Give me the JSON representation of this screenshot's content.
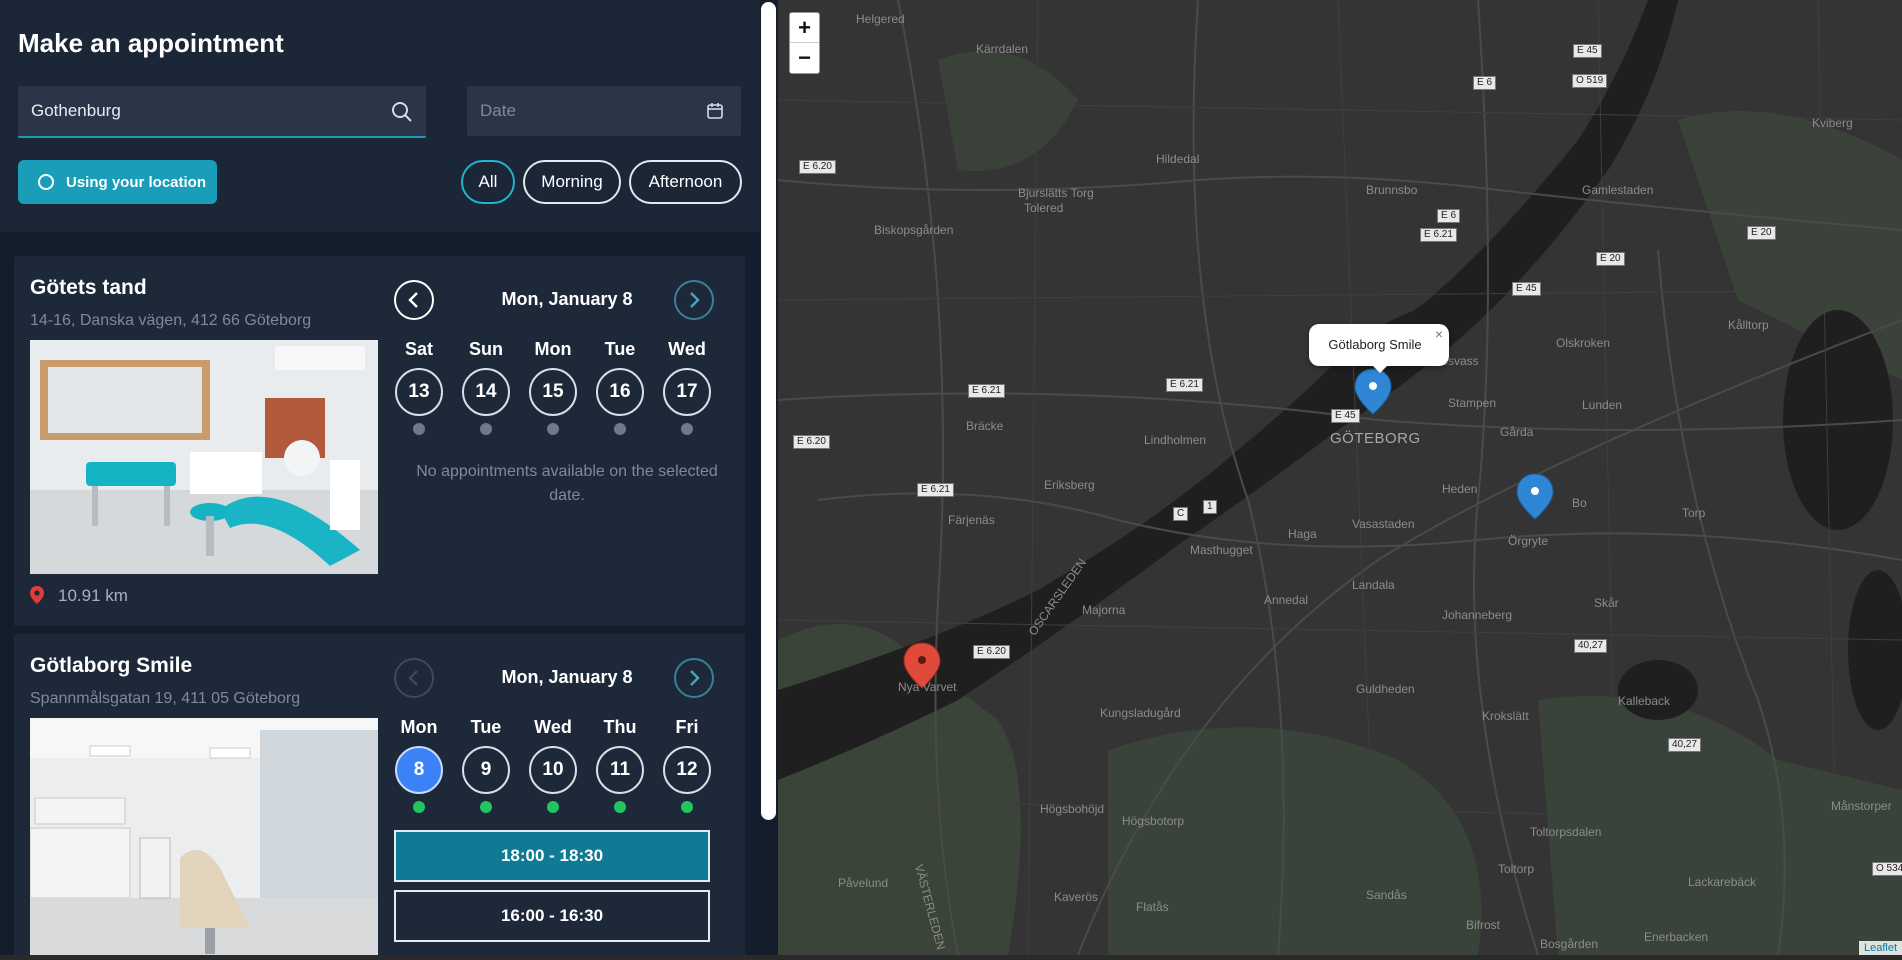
{
  "header": {
    "title": "Make an appointment"
  },
  "search": {
    "value": "Gothenburg",
    "date_placeholder": "Date"
  },
  "location_button": {
    "label": "Using your location"
  },
  "filters": [
    "All",
    "Morning",
    "Afternoon"
  ],
  "filters_active": "All",
  "clinics": [
    {
      "name": "Götets tand",
      "address": "14-16, Danska vägen, 412 66 Göteborg",
      "distance": "10.91 km",
      "date_title": "Mon, January 8",
      "days": [
        {
          "dow": "Sat",
          "num": "13"
        },
        {
          "dow": "Sun",
          "num": "14"
        },
        {
          "dow": "Mon",
          "num": "15"
        },
        {
          "dow": "Tue",
          "num": "16"
        },
        {
          "dow": "Wed",
          "num": "17"
        }
      ],
      "message": "No appointments available on the selected date."
    },
    {
      "name": "Götlaborg Smile",
      "address": "Spannmålsgatan 19, 411 05 Göteborg",
      "date_title": "Mon, January 8",
      "days": [
        {
          "dow": "Mon",
          "num": "8"
        },
        {
          "dow": "Tue",
          "num": "9"
        },
        {
          "dow": "Wed",
          "num": "10"
        },
        {
          "dow": "Thu",
          "num": "11"
        },
        {
          "dow": "Fri",
          "num": "12"
        }
      ],
      "slots": [
        "18:00 - 18:30",
        "16:00 - 16:30"
      ]
    }
  ],
  "map": {
    "zoom_in": "+",
    "zoom_out": "−",
    "popup": "Götlaborg Smile",
    "popup_close": "×",
    "attribution": "Leaflet",
    "labels": {
      "helgered": "Helgered",
      "karrdalen": "Kärrdalen",
      "hildedal": "Hildedal",
      "bjurslatts": "Bjurslätts Torg",
      "tolered": "Tolered",
      "biskops": "Biskopsgården",
      "brunnsbo": "Brunnsbo",
      "gamlestaden": "Gamlestaden",
      "kviberg": "Kviberg",
      "kalltorp": "Kålltorp",
      "olskroken": "Olskroken",
      "lunden": "Lunden",
      "stampen": "Stampen",
      "garda": "Gårda",
      "goteborg": "GÖTEBORG",
      "lindholmen": "Lindholmen",
      "bracke": "Bräcke",
      "eriksberg": "Eriksberg",
      "farjenas": "Färjenäs",
      "heden": "Heden",
      "vasastaden": "Vasastaden",
      "haga": "Haga",
      "masthugget": "Masthugget",
      "orgryte": "Örgryte",
      "torp": "Torp",
      "landala": "Landala",
      "annedal": "Annedal",
      "majorna": "Majorna",
      "johanneberg": "Johanneberg",
      "skar": "Skår",
      "guldheden": "Guldheden",
      "krokslatt": "Krokslätt",
      "kalleback": "Kalleback",
      "nyavarvet": "Nya Varvet",
      "kungsladugard": "Kungsladugård",
      "hogsbohojd": "Högsbohöjd",
      "hogsbotorp": "Högsbotorp",
      "toltorpsdalen": "Toltorpsdalen",
      "toltorp": "Toltorp",
      "pavelund": "Påvelund",
      "kaveros": "Kaverös",
      "flatas": "Flatås",
      "sandas": "Sandås",
      "bifrost": "Bifrost",
      "bosgarden": "Bosgården",
      "enerbacken": "Enerbacken",
      "lackareback": "Lackarebäck",
      "manstorp": "Månstorper",
      "oscarsleden": "OSCARSLEDEN",
      "vasterleden": "VÄSTERLEDEN",
      "bo": "Bo",
      "ssvass": "ssvass"
    },
    "shields": [
      "E 45",
      "E 6",
      "O 519",
      "E 6.20",
      "E 6.21",
      "E 6",
      "E 20",
      "E 20",
      "E 45",
      "E 6.21",
      "E 6.21",
      "E 45",
      "E 6.20",
      "E 6.21",
      "C",
      "1",
      "E 6.20",
      "40,27",
      "40,27",
      "O 534"
    ]
  },
  "colors": {
    "accent": "#1a9db8",
    "selected_day": "#3b82f6",
    "slot_active": "#0f7a93",
    "marker_blue": "#2e86d4",
    "marker_red": "#e04a3a"
  }
}
